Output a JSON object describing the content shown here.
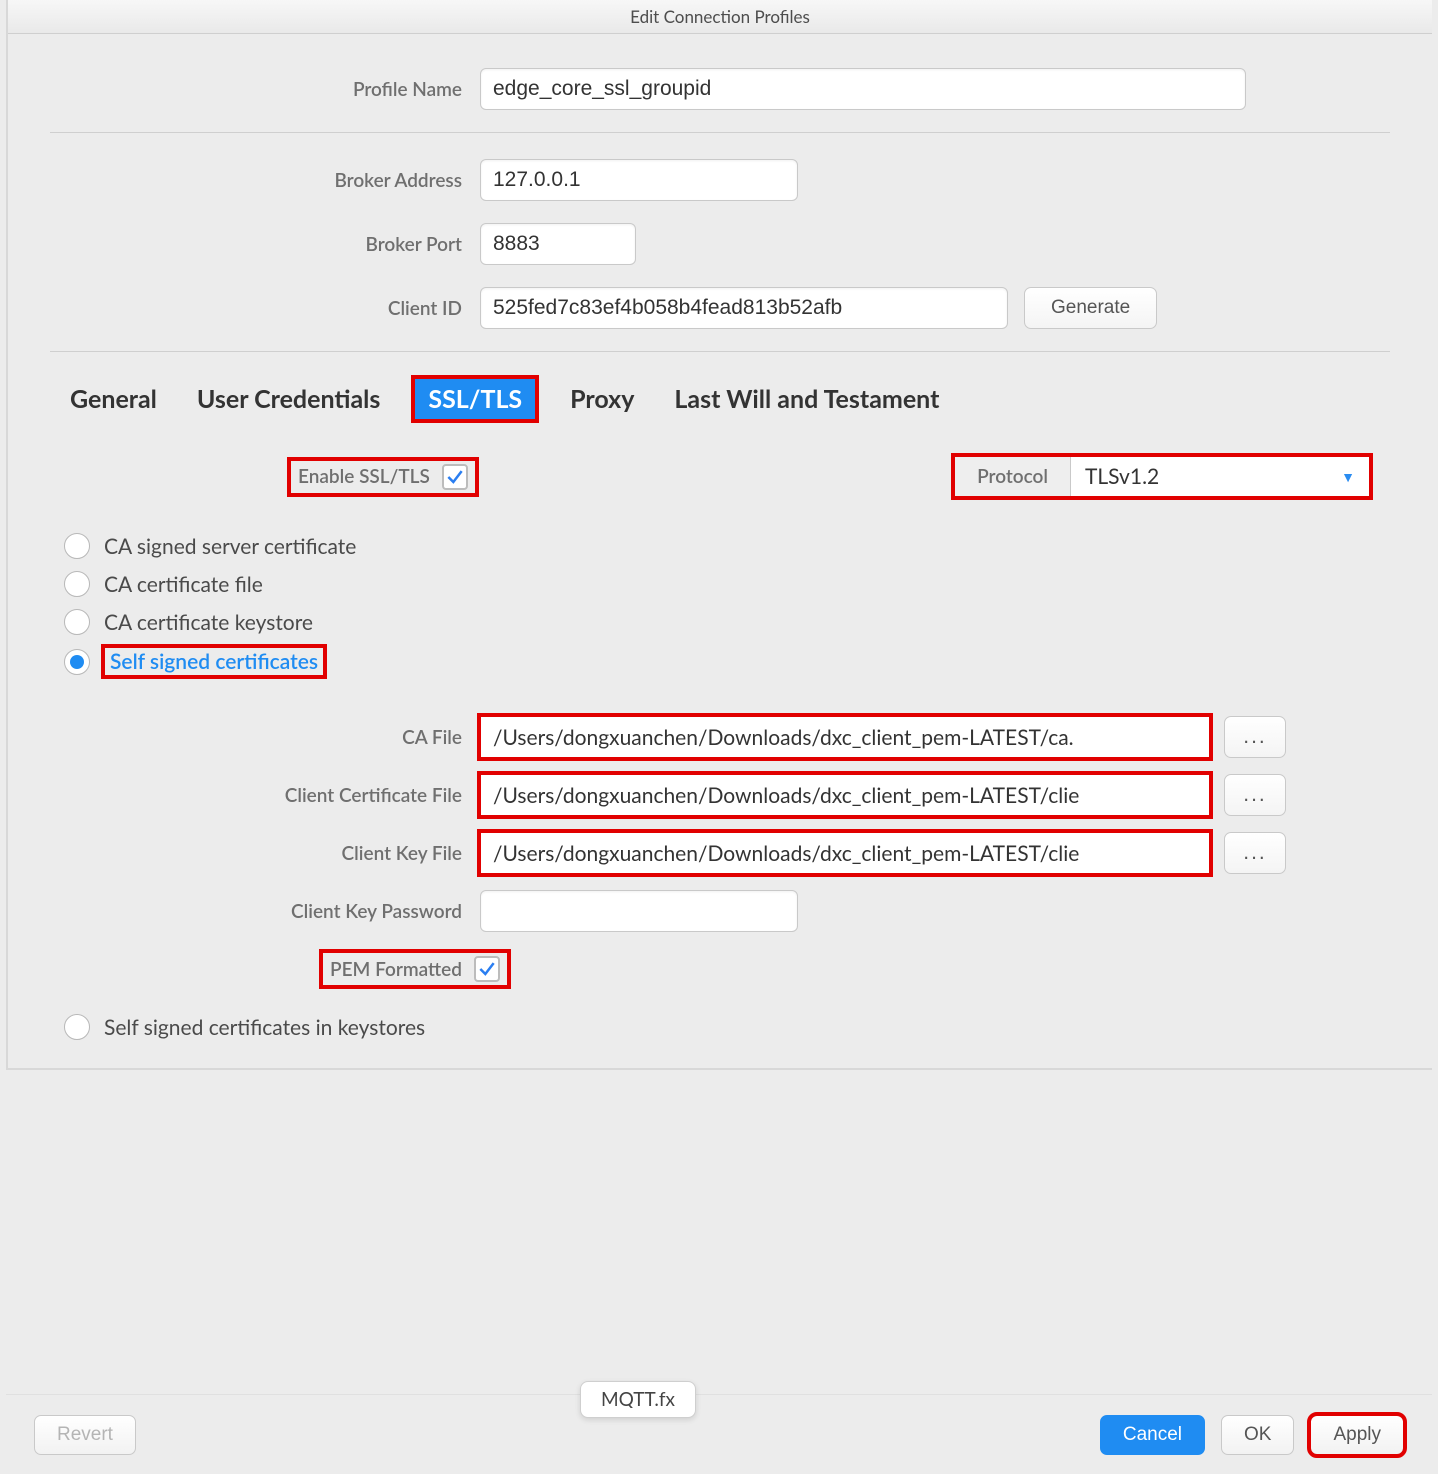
{
  "title": "Edit Connection Profiles",
  "profile": {
    "name_label": "Profile Name",
    "name_value": "edge_core_ssl_groupid",
    "broker_addr_label": "Broker Address",
    "broker_addr_value": "127.0.0.1",
    "broker_port_label": "Broker Port",
    "broker_port_value": "8883",
    "client_id_label": "Client ID",
    "client_id_value": "525fed7c83ef4b058b4fead813b52afb",
    "generate_label": "Generate"
  },
  "tabs": {
    "general": "General",
    "user_creds": "User Credentials",
    "ssl": "SSL/TLS",
    "proxy": "Proxy",
    "lwt": "Last Will and Testament"
  },
  "ssl": {
    "enable_label": "Enable SSL/TLS",
    "protocol_label": "Protocol",
    "protocol_value": "TLSv1.2",
    "radio_ca_signed": "CA signed server certificate",
    "radio_ca_file": "CA certificate file",
    "radio_ca_keystore": "CA certificate keystore",
    "radio_self_signed": "Self signed certificates",
    "radio_self_signed_ks": "Self signed certificates in keystores",
    "ca_file_label": "CA File",
    "ca_file_value": "/Users/dongxuanchen/Downloads/dxc_client_pem-LATEST/ca.",
    "client_cert_label": "Client Certificate File",
    "client_cert_value": "/Users/dongxuanchen/Downloads/dxc_client_pem-LATEST/clie",
    "client_key_label": "Client Key File",
    "client_key_value": "/Users/dongxuanchen/Downloads/dxc_client_pem-LATEST/clie",
    "client_key_pw_label": "Client Key Password",
    "pem_label": "PEM Formatted",
    "browse_label": "..."
  },
  "footer": {
    "revert": "Revert",
    "cancel": "Cancel",
    "ok": "OK",
    "apply": "Apply",
    "tooltip": "MQTT.fx"
  }
}
